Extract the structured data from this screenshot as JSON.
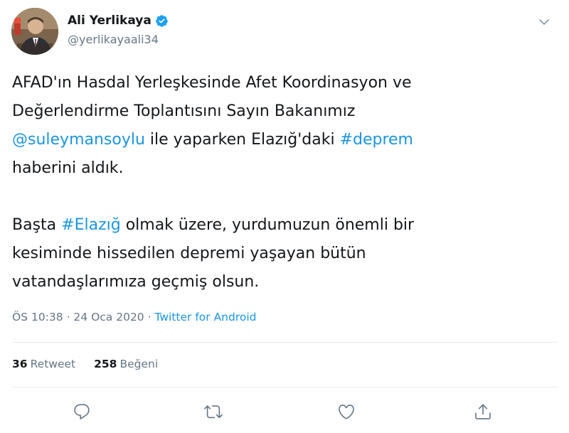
{
  "author": {
    "name": "Ali Yerlikaya",
    "handle": "@yerlikayaali34",
    "verified": true
  },
  "tweet": {
    "line1": "AFAD'ın Hasdal Yerleşkesinde Afet Koordinasyon ve",
    "line2": "Değerlendirme Toplantısını Sayın Bakanımız",
    "mention": "@suleymansoylu",
    "line3_mid": " ile yaparken Elazığ'daki ",
    "hashtag1": "#deprem",
    "line4": " haberini aldık.",
    "p2_start": "Başta ",
    "hashtag2": "#Elazığ",
    "p2_rest1": " olmak üzere, yurdumuzun önemli bir",
    "p2_line2": "kesiminde hissedilen depremi yaşayan bütün",
    "p2_line3": "vatandaşlarımıza geçmiş olsun."
  },
  "meta": {
    "time": "ÖS 10:38",
    "sep1": " · ",
    "date": "24 Oca 2020",
    "sep2": " · ",
    "source": "Twitter for Android"
  },
  "stats": {
    "retweets_count": "36",
    "retweets_label": "Retweet",
    "likes_count": "258",
    "likes_label": "Beğeni"
  },
  "icons": {
    "reply": "reply-icon",
    "retweet": "retweet-icon",
    "like": "heart-icon",
    "share": "share-icon",
    "caret": "chevron-down-icon",
    "verified": "verified-badge-icon"
  },
  "colors": {
    "link": "#1b95e0",
    "secondary_text": "#657786",
    "verified": "#1da1f2",
    "divider": "#e6ecf0"
  }
}
